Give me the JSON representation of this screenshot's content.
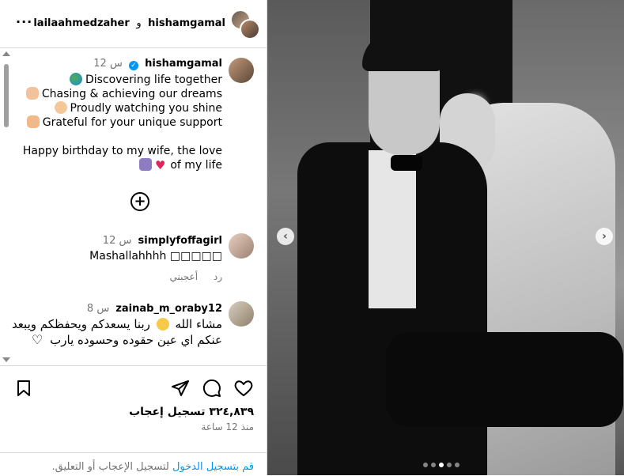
{
  "header": {
    "user1": "lailaahmedzaher",
    "conj": "و",
    "user2": "hishamgamal",
    "more": "···"
  },
  "post": {
    "username": "hishamgamal",
    "time": "12 س",
    "caption_lines": [
      "Discovering life together",
      "Chasing & achieving our dreams",
      "Proudly watching you shine",
      "Grateful for your unique support",
      "",
      "Happy birthday to my wife, the love",
      "of my life"
    ],
    "emoji_names": [
      "globe-emoji",
      "muscle-emoji",
      "clap-emoji",
      "pray-emoji",
      "infinity-emoji",
      "red-heart-emoji"
    ]
  },
  "comments": [
    {
      "username": "simplyfoffagirl",
      "time": "12 س",
      "text": "Mashallahhhh □□□□□",
      "like_label": "أعجبني",
      "reply_label": "رد"
    },
    {
      "username": "zainab_m_oraby12",
      "time": "8 س",
      "text_before": "مشاء الله",
      "text_after": "ربنا يسعدكم ويحفظكم ويبعد عنكم اي عين حقوده وحسوده يارب"
    }
  ],
  "footer": {
    "likes": "٣٢٤,٨٣٩ تسجيل إعجاب",
    "time_ago": "منذ 12 ساعة",
    "login_link": "قم بتسجيل الدخول",
    "login_rest": "لتسجيل الإعجاب أو التعليق."
  },
  "carousel": {
    "slide_count": 5,
    "active_index": 2
  },
  "colors": {
    "link": "#0095f6",
    "verified": "#0095f6",
    "muted": "#737373",
    "border": "#dbdbdb"
  }
}
